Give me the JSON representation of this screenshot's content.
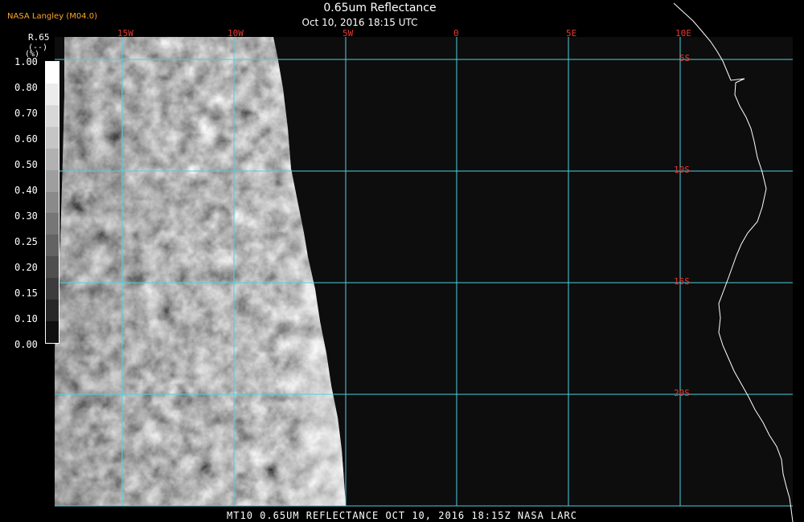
{
  "header": {
    "agency_label": "NASA Langley (M04.0)",
    "title": "0.65um Reflectance",
    "subtitle": "Oct 10, 2016 18:15 UTC"
  },
  "legend": {
    "title": "R.65",
    "sub1": "(--)",
    "sub2": "(%)",
    "ticks": [
      "1.00",
      "0.80",
      "0.70",
      "0.60",
      "0.50",
      "0.40",
      "0.30",
      "0.25",
      "0.20",
      "0.15",
      "0.10",
      "0.00"
    ],
    "ramp_colors": [
      "#ffffff",
      "#ececec",
      "#d8d8d8",
      "#c5c5c5",
      "#b1b1b1",
      "#9e9e9e",
      "#8a8a8a",
      "#767676",
      "#636363",
      "#4f4f4f",
      "#3c3c3c",
      "#282828",
      "#101010"
    ]
  },
  "map": {
    "longitude_labels": [
      "15W",
      "10W",
      "5W",
      "0",
      "5E",
      "10E"
    ],
    "latitude_labels": [
      "5S",
      "10S",
      "15S",
      "20S"
    ],
    "grid_color": "#4dd0e1",
    "label_color": "#e53935",
    "coastline_color": "#ffffff"
  },
  "footer": {
    "text": "MT10  0.65UM REFLECTANCE   OCT 10, 2016 18:15Z   NASA LARC"
  }
}
